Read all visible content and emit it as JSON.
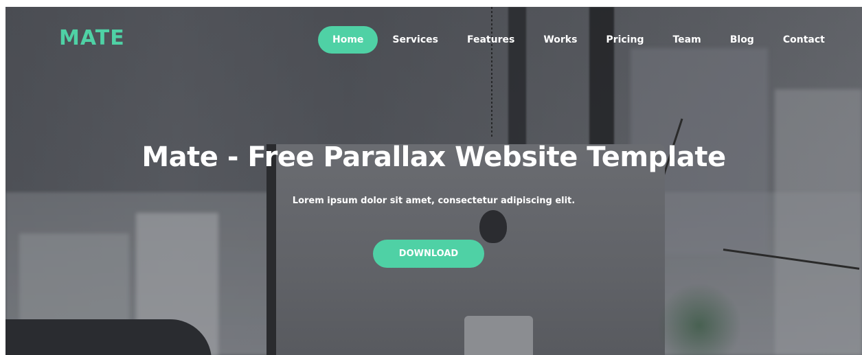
{
  "brand": {
    "logo_text": "MATE",
    "accent_color": "#4fd1a5"
  },
  "nav": {
    "items": [
      {
        "label": "Home",
        "active": true
      },
      {
        "label": "Services",
        "active": false
      },
      {
        "label": "Features",
        "active": false
      },
      {
        "label": "Works",
        "active": false
      },
      {
        "label": "Pricing",
        "active": false
      },
      {
        "label": "Team",
        "active": false
      },
      {
        "label": "Blog",
        "active": false
      },
      {
        "label": "Contact",
        "active": false
      }
    ]
  },
  "hero": {
    "title": "Mate - Free Parallax Website Template",
    "subtitle": "Lorem ipsum dolor sit amet, consectetur adipiscing elit.",
    "cta_label": "DOWNLOAD"
  }
}
